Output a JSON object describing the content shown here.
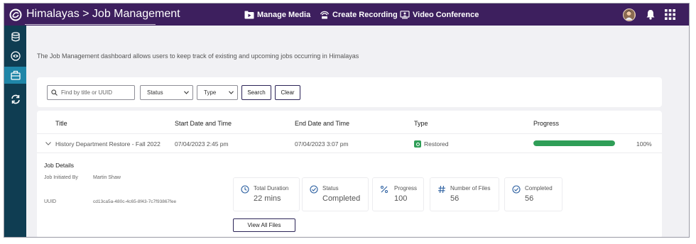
{
  "header": {
    "title": "Himalayas > Job Management",
    "nav": [
      {
        "label": "Manage Media",
        "icon": "media-folder-icon"
      },
      {
        "label": "Create Recording",
        "icon": "recording-icon"
      },
      {
        "label": "Video Conference",
        "icon": "video-conference-icon"
      }
    ],
    "icons": [
      "logo-icon",
      "user-avatar",
      "bell-icon",
      "app-grid-icon"
    ]
  },
  "sidebar": {
    "items": [
      {
        "icon": "database-icon",
        "active": false
      },
      {
        "icon": "eye-icon",
        "active": false
      },
      {
        "icon": "briefcase-icon",
        "active": true
      },
      {
        "icon": "sync-icon",
        "active": false
      }
    ]
  },
  "description": "The Job Management dashboard allows users to keep track of existing and upcoming jobs occurring in Himalayas",
  "filters": {
    "search_placeholder": "Find by title or UUID",
    "status_label": "Status",
    "type_label": "Type",
    "search_button": "Search",
    "clear_button": "Clear"
  },
  "table": {
    "columns": [
      "Title",
      "Start Date and Time",
      "End Date and Time",
      "Type",
      "Progress"
    ],
    "rows": [
      {
        "title": "History Department Restore - Fall 2022",
        "start": "07/04/2023 2:45 pm",
        "end": "07/04/2023 3:07 pm",
        "type": "Restored",
        "progress": 100,
        "progress_label": "100%"
      }
    ]
  },
  "details": {
    "heading": "Job Details",
    "initiated_label": "Job Initiated By",
    "initiated_value": "Martin Shaw",
    "uuid_label": "UUID",
    "uuid_value": "cd13ca5a-480c-4c65-8f43-7c7f93867fee",
    "stats": [
      {
        "label": "Total Duration",
        "value": "22 mins"
      },
      {
        "label": "Status",
        "value": "Completed"
      },
      {
        "label": "Progress",
        "value": "100"
      },
      {
        "label": "Number of Files",
        "value": "56"
      },
      {
        "label": "Completed",
        "value": "56"
      }
    ],
    "view_files_button": "View All Files"
  },
  "colors": {
    "topbar": "#3d1f5e",
    "sidebar": "#0f3d52",
    "sidebar_active": "#1f86a8",
    "success": "#2f9e57",
    "accent": "#2b5fa0"
  }
}
